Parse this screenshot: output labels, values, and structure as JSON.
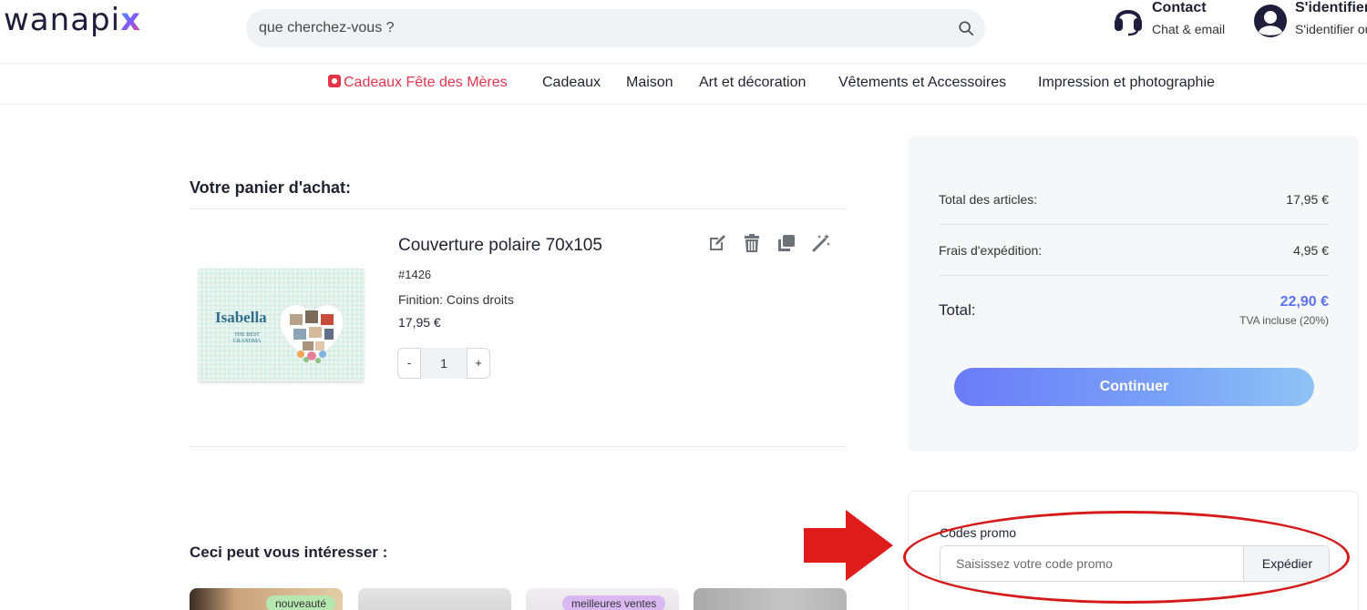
{
  "header": {
    "logo_main": "wanapi",
    "logo_x": "x",
    "search_placeholder": "que cherchez-vous ?",
    "contact": {
      "title": "Contact",
      "subtitle": "Chat & email"
    },
    "login": {
      "title": "S'identifier",
      "subtitle": "S'identifier ou"
    }
  },
  "nav": {
    "items": [
      {
        "label": "Cadeaux Fête des Mères",
        "highlight": true
      },
      {
        "label": "Cadeaux"
      },
      {
        "label": "Maison"
      },
      {
        "label": "Art et décoration"
      },
      {
        "label": "Vêtements et Accessoires"
      },
      {
        "label": "Impression et photographie"
      }
    ]
  },
  "cart": {
    "title": "Votre panier d'achat:",
    "item": {
      "name": "Couverture polaire 70x105",
      "ref": "#1426",
      "finish": "Finition: Coins droits",
      "price": "17,95 €",
      "quantity": "1",
      "minus_label": "-",
      "plus_label": "+",
      "image_text_name": "Isabella",
      "image_text_sub": "THE BEST GRANDMA",
      "actions": [
        "edit-icon",
        "trash-icon",
        "duplicate-icon",
        "magic-wand-icon"
      ]
    }
  },
  "summary": {
    "items_label": "Total des articles:",
    "items_value": "17,95 €",
    "shipping_label": "Frais d'expédition:",
    "shipping_value": "4,95 €",
    "total_label": "Total:",
    "total_value": "22,90 €",
    "tax_note": "TVA incluse (20%)",
    "continue_label": "Continuer"
  },
  "promo": {
    "label": "Codes promo",
    "placeholder": "Saisissez votre code promo",
    "submit_label": "Expédier"
  },
  "suggestions": {
    "title": "Ceci peut vous intéresser :",
    "badges": [
      "nouveauté",
      "meilleures ventes"
    ]
  },
  "colors": {
    "accent": "#5b73f5",
    "highlight_nav": "#e5354d",
    "annotation": "#d51a1a"
  }
}
